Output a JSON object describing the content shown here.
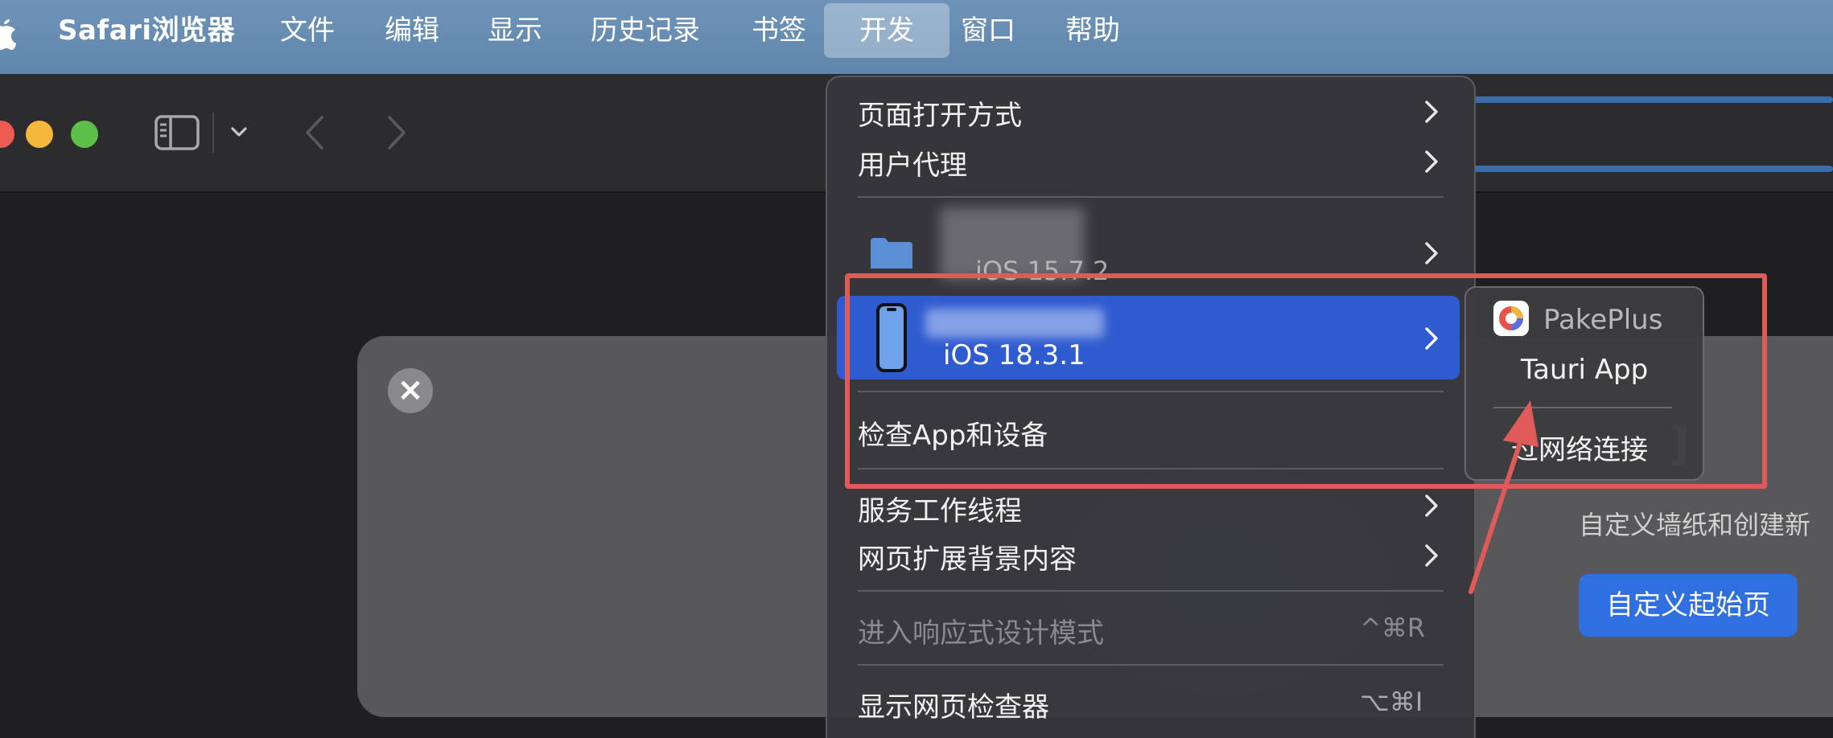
{
  "menubar": {
    "app_name": "Safari浏览器",
    "items": [
      "文件",
      "编辑",
      "显示",
      "历史记录",
      "书签",
      "开发",
      "窗口",
      "帮助"
    ],
    "active_item": "开发"
  },
  "develop_menu": {
    "open_page_with": "页面打开方式",
    "user_agent": "用户代理",
    "device_mac_os": "iOS 15.7.2",
    "device_iphone_os": "iOS 18.3.1",
    "inspect_apps": "检查App和设备",
    "service_workers": "服务工作线程",
    "extension_background": "网页扩展背景内容",
    "responsive_design": "进入响应式设计模式",
    "responsive_shortcut": "^⌘R",
    "show_inspector": "显示网页检查器",
    "inspector_shortcut": "⌥⌘I"
  },
  "submenu": {
    "app_name": "PakePlus",
    "page_name": "Tauri App",
    "network_connect": "过网络连接"
  },
  "start_page": {
    "promo_text": "自定义墙纸和创建新",
    "promo_button": "自定义起始页"
  },
  "colors": {
    "menubar": "#6788b0",
    "highlight": "#2f5bd0",
    "annotation": "#e05a5a",
    "promo_button": "#2f6fe0"
  }
}
